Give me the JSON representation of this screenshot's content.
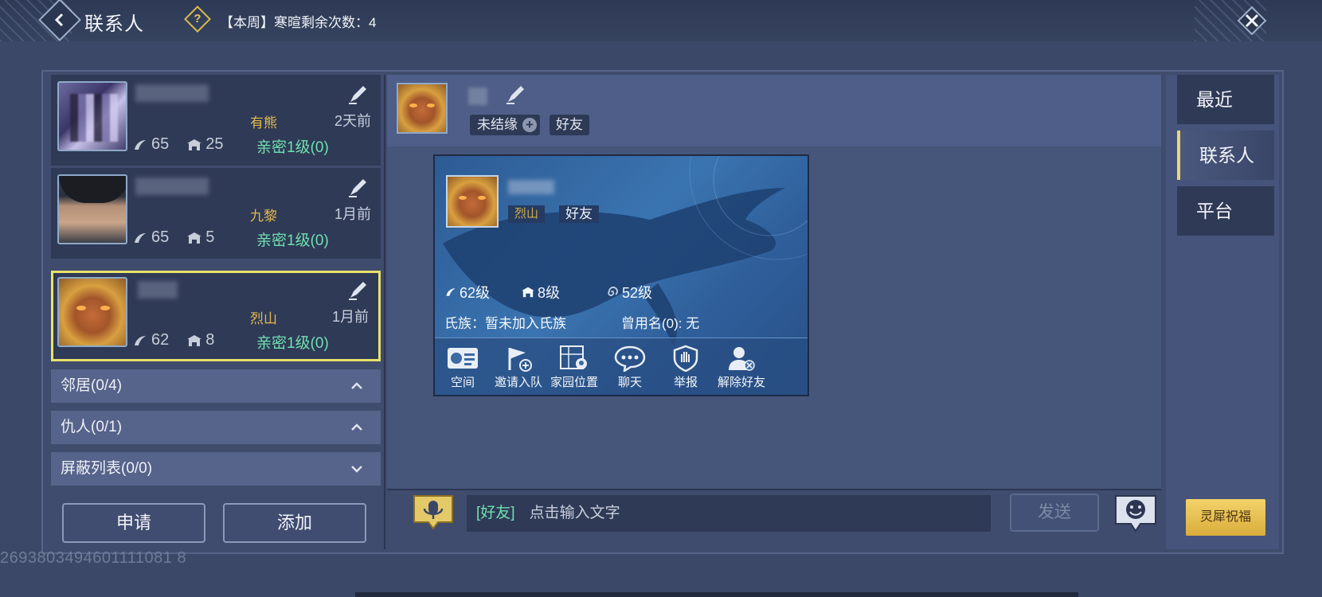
{
  "header": {
    "title": "联系人",
    "weekly_greeting": "【本周】寒暄剩余次数：4"
  },
  "contacts": [
    {
      "clan": "有熊",
      "time": "2天前",
      "level": "65",
      "home_level": "25",
      "intimacy": "亲密1级(0)"
    },
    {
      "clan": "九黎",
      "time": "1月前",
      "level": "65",
      "home_level": "5",
      "intimacy": "亲密1级(0)"
    },
    {
      "clan": "烈山",
      "time": "1月前",
      "level": "62",
      "home_level": "8",
      "intimacy": "亲密1级(0)"
    }
  ],
  "groups": [
    {
      "label": "邻居(0/4)",
      "state": "expanded"
    },
    {
      "label": "仇人(0/1)",
      "state": "expanded"
    },
    {
      "label": "屏蔽列表(0/0)",
      "state": "collapsed"
    }
  ],
  "buttons": {
    "apply": "申请",
    "add": "添加"
  },
  "chat_header": {
    "tag_unbound": "未结缘",
    "tag_friend": "好友"
  },
  "profile_popup": {
    "clan": "烈山",
    "relation": "好友",
    "level": "62级",
    "home_level": "8级",
    "spirit_level": "52级",
    "clan_line": "氏族：暂未加入氏族",
    "former_names": "曾用名(0): 无",
    "actions": [
      "空间",
      "邀请入队",
      "家园位置",
      "聊天",
      "举报",
      "解除好友"
    ]
  },
  "input": {
    "channel": "[好友]",
    "placeholder": "点击输入文字",
    "send": "发送"
  },
  "right_tabs": [
    {
      "label": "最近",
      "active": false
    },
    {
      "label": "联系人",
      "active": true
    },
    {
      "label": "平台",
      "active": false
    }
  ],
  "bless_button": "灵犀祝福",
  "uid": "2693803494601111081 8",
  "colors": {
    "accent_gold": "#e3b94b",
    "intimacy_green": "#6fe0b0",
    "selected_border": "#e8e26a"
  }
}
